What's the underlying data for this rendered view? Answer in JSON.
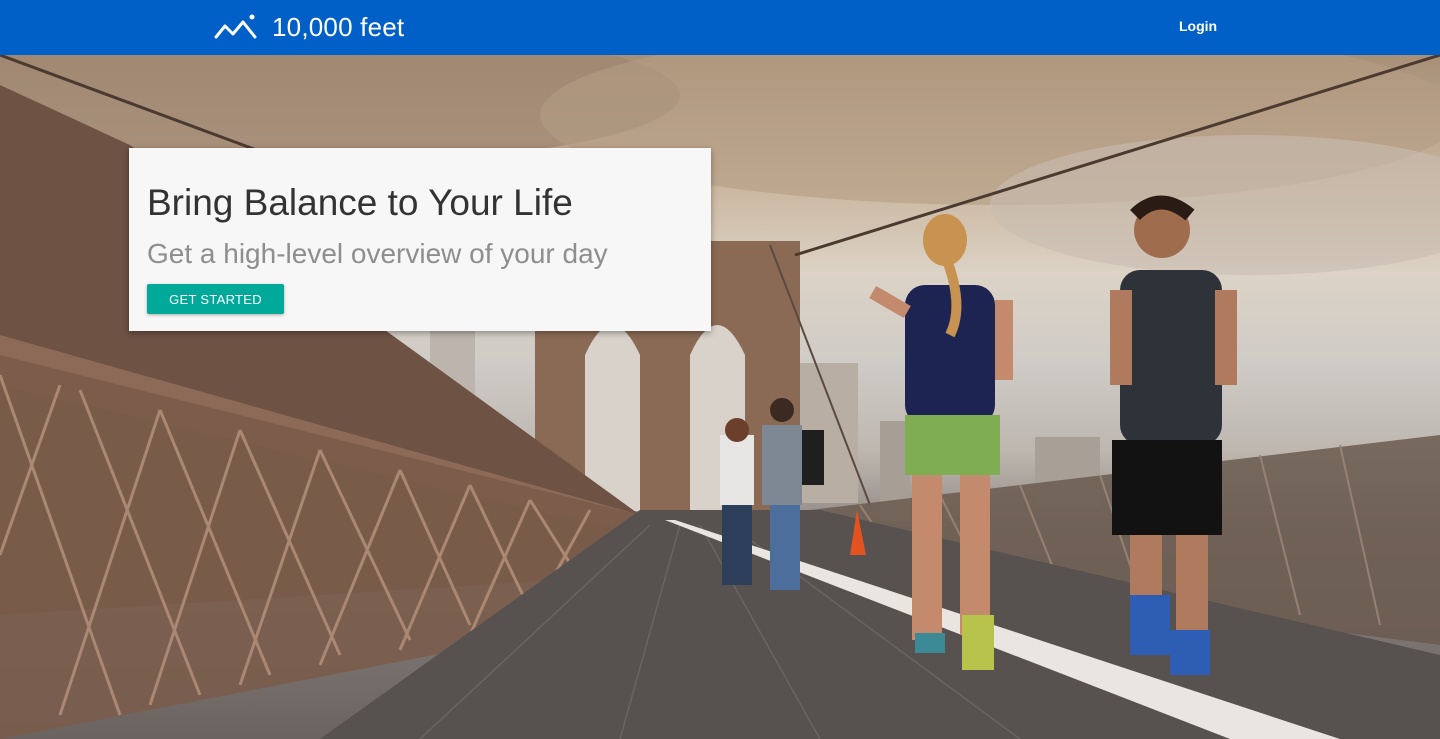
{
  "navbar": {
    "brand_name": "10,000 feet",
    "brand_icon": "mountain-logo-icon",
    "login_label": "Login",
    "background_color": "#0060c8"
  },
  "hero": {
    "image_description_icon": "runners-bridge-photo",
    "card": {
      "title": "Bring Balance to Your Life",
      "subtitle": "Get a high-level overview of your day",
      "cta_label": "GET STARTED",
      "cta_color": "#00a99a"
    }
  }
}
